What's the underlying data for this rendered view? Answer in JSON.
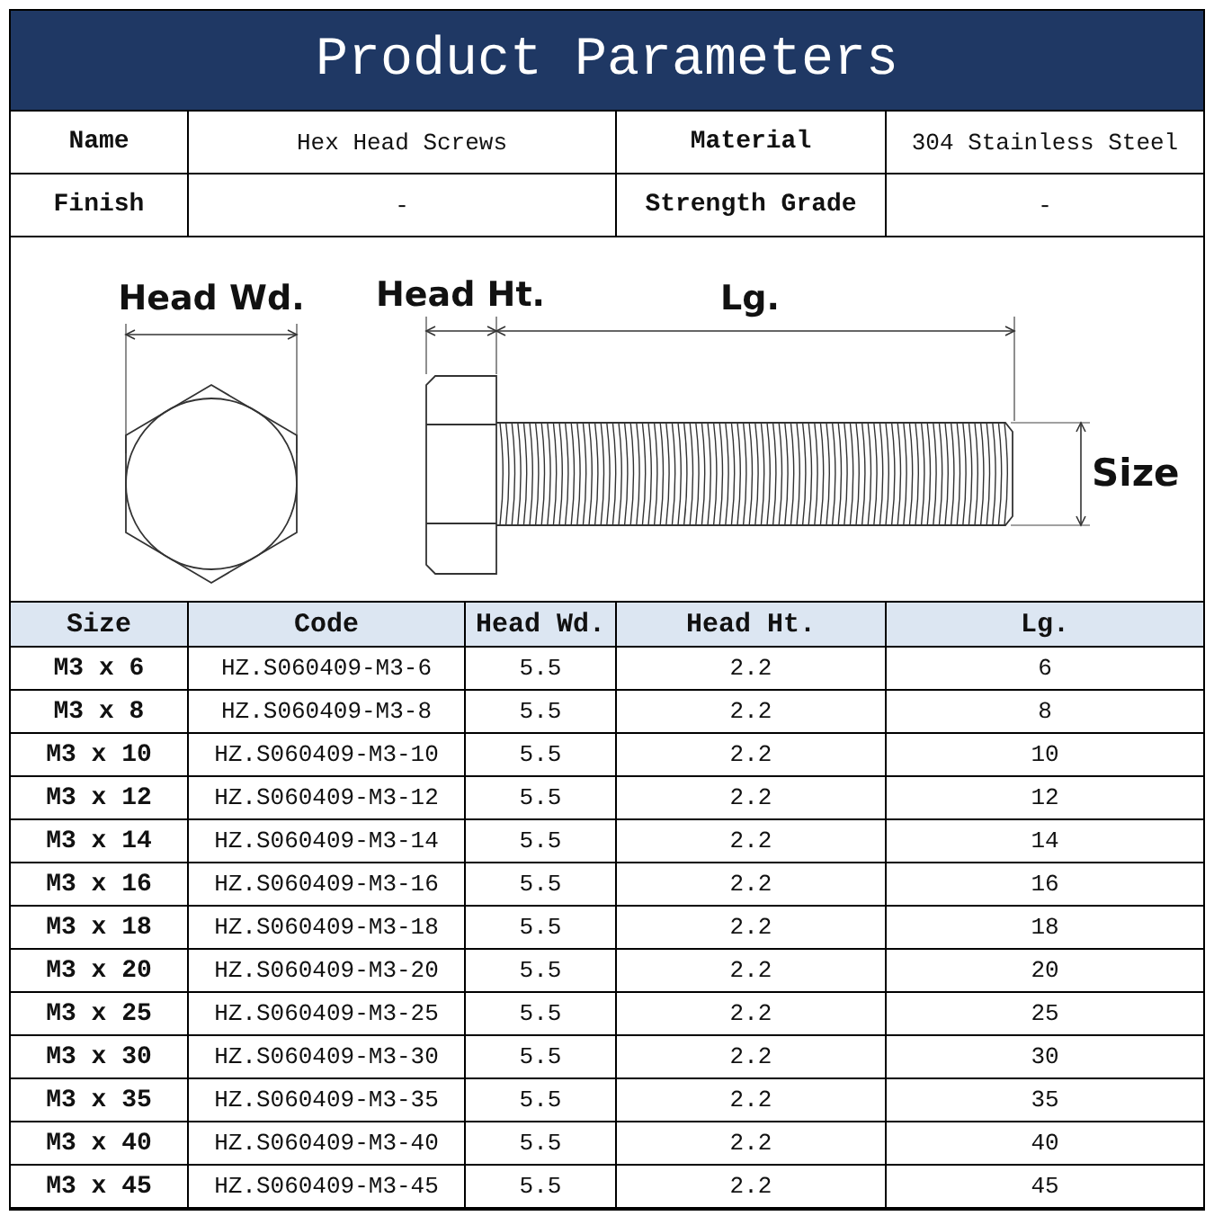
{
  "title": "Product Parameters",
  "info": [
    {
      "label": "Name",
      "value": "Hex Head Screws"
    },
    {
      "label": "Material",
      "value": "304 Stainless Steel"
    },
    {
      "label": "Finish",
      "value": "-"
    },
    {
      "label": "Strength Grade",
      "value": "-"
    }
  ],
  "drawing": {
    "labels": {
      "head_width": "Head Wd.",
      "head_height": "Head Ht.",
      "length": "Lg.",
      "size": "Size"
    }
  },
  "table": {
    "columns": [
      "Size",
      "Code",
      "Head Wd.",
      "Head Ht.",
      "Lg."
    ],
    "rows": [
      [
        "M3 x 6",
        "HZ.S060409-M3-6",
        "5.5",
        "2.2",
        "6"
      ],
      [
        "M3 x 8",
        "HZ.S060409-M3-8",
        "5.5",
        "2.2",
        "8"
      ],
      [
        "M3 x 10",
        "HZ.S060409-M3-10",
        "5.5",
        "2.2",
        "10"
      ],
      [
        "M3 x 12",
        "HZ.S060409-M3-12",
        "5.5",
        "2.2",
        "12"
      ],
      [
        "M3 x 14",
        "HZ.S060409-M3-14",
        "5.5",
        "2.2",
        "14"
      ],
      [
        "M3 x 16",
        "HZ.S060409-M3-16",
        "5.5",
        "2.2",
        "16"
      ],
      [
        "M3 x 18",
        "HZ.S060409-M3-18",
        "5.5",
        "2.2",
        "18"
      ],
      [
        "M3 x 20",
        "HZ.S060409-M3-20",
        "5.5",
        "2.2",
        "20"
      ],
      [
        "M3 x 25",
        "HZ.S060409-M3-25",
        "5.5",
        "2.2",
        "25"
      ],
      [
        "M3 x 30",
        "HZ.S060409-M3-30",
        "5.5",
        "2.2",
        "30"
      ],
      [
        "M3 x 35",
        "HZ.S060409-M3-35",
        "5.5",
        "2.2",
        "35"
      ],
      [
        "M3 x 40",
        "HZ.S060409-M3-40",
        "5.5",
        "2.2",
        "40"
      ],
      [
        "M3 x 45",
        "HZ.S060409-M3-45",
        "5.5",
        "2.2",
        "45"
      ]
    ]
  }
}
